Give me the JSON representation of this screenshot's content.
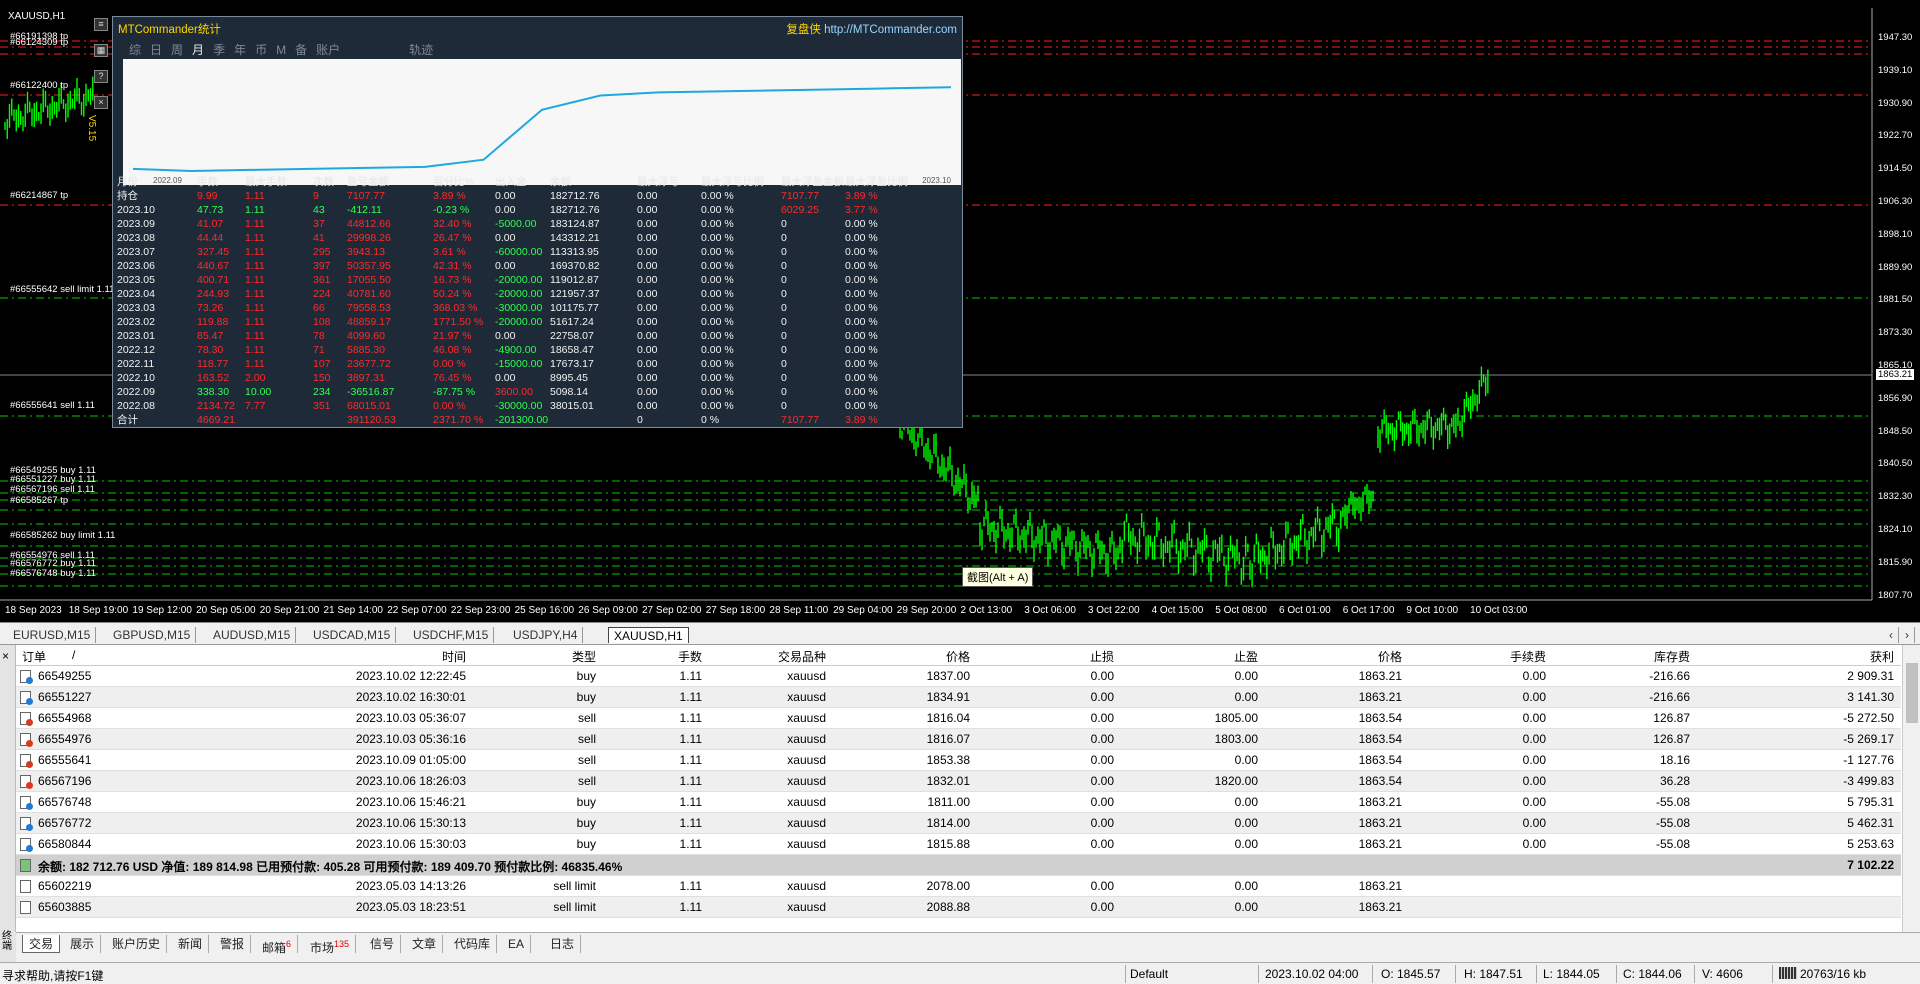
{
  "chart": {
    "symbol_label": "XAUUSD,H1",
    "current_price": "1863.21",
    "price_ticks": [
      "1947.30",
      "1939.10",
      "1930.90",
      "1922.70",
      "1914.50",
      "1906.30",
      "1898.10",
      "1889.90",
      "1881.50",
      "1873.30",
      "1865.10",
      "1856.90",
      "1848.50",
      "1840.50",
      "1832.30",
      "1824.10",
      "1815.90",
      "1807.70"
    ],
    "time_ticks": [
      "18 Sep 2023",
      "18 Sep 19:00",
      "19 Sep 12:00",
      "20 Sep 05:00",
      "20 Sep 21:00",
      "21 Sep 14:00",
      "22 Sep 07:00",
      "22 Sep 23:00",
      "25 Sep 16:00",
      "26 Sep 09:00",
      "27 Sep 02:00",
      "27 Sep 18:00",
      "28 Sep 11:00",
      "29 Sep 04:00",
      "29 Sep 20:00",
      "2 Oct 13:00",
      "3 Oct 06:00",
      "3 Oct 22:00",
      "4 Oct 15:00",
      "5 Oct 08:00",
      "6 Oct 01:00",
      "6 Oct 17:00",
      "9 Oct 10:00",
      "10 Oct 03:00"
    ],
    "order_labels": [
      "#66191398 tp",
      "#66124309 tp",
      "#66122400 tp",
      "#66214867 tp",
      "#66555642 sell limit 1.11",
      "#66555641 sell 1.11",
      "#66549255 buy 1.11",
      "#66551227 buy 1.11",
      "#66567196 sell 1.11",
      "#66585267 tp",
      "#66585262 buy limit 1.11",
      "#66554976 sell 1.11",
      "#66576772 buy 1.11",
      "#66576748 buy 1.11"
    ],
    "screenshot_tip": "截图(Alt + A)",
    "side_icons": [
      "list-icon",
      "grid-icon",
      "question-icon",
      "close-icon"
    ],
    "version_label": "V5.15"
  },
  "mtc": {
    "title": "MTCommander统计",
    "link_prefix": "复盘侠",
    "link_url": "http://MTCommander.com",
    "tabs": [
      "综",
      "日",
      "周",
      "月",
      "季",
      "年",
      "币",
      "M",
      "备",
      "账户",
      "轨迹"
    ],
    "active_tab": "月",
    "plot": {
      "x_start": "2022.09",
      "x_end": "2023.10",
      "line_color": "#1fa8e0",
      "equity": [
        0.04,
        0.02,
        0.03,
        0.04,
        0.05,
        0.06,
        0.13,
        0.62,
        0.76,
        0.79,
        0.8,
        0.81,
        0.82,
        0.83,
        0.84
      ]
    },
    "columns": [
      "月份",
      "手数",
      "最大手数",
      "次数",
      "盈亏金额",
      "百分比%",
      "出入金",
      "余额",
      "最大浮亏",
      "最大浮亏比例",
      "最大浮盈金额",
      "最大浮盈比例"
    ],
    "rows": [
      {
        "c": [
          "持仓",
          "9.99",
          "1.11",
          "9",
          "7107.77",
          "3.89 %",
          "0.00",
          "182712.76",
          "0.00",
          "0.00 %",
          "7107.77",
          "3.89 %"
        ],
        "t": [
          "w",
          "r",
          "r",
          "r",
          "r",
          "r",
          "w",
          "w",
          "w",
          "w",
          "r",
          "r"
        ]
      },
      {
        "c": [
          "2023.10",
          "47.73",
          "1.11",
          "43",
          "-412.11",
          "-0.23 %",
          "0.00",
          "182712.76",
          "0.00",
          "0.00 %",
          "6029.25",
          "3.77 %"
        ],
        "t": [
          "w",
          "g",
          "g",
          "g",
          "g",
          "g",
          "w",
          "w",
          "w",
          "w",
          "r",
          "r"
        ]
      },
      {
        "c": [
          "2023.09",
          "41.07",
          "1.11",
          "37",
          "44812.66",
          "32.40 %",
          "-5000.00",
          "183124.87",
          "0.00",
          "0.00 %",
          "0",
          "0.00 %"
        ],
        "t": [
          "w",
          "r",
          "r",
          "r",
          "r",
          "r",
          "g",
          "w",
          "w",
          "w",
          "w",
          "w"
        ]
      },
      {
        "c": [
          "2023.08",
          "44.44",
          "1.11",
          "41",
          "29998.26",
          "26.47 %",
          "0.00",
          "143312.21",
          "0.00",
          "0.00 %",
          "0",
          "0.00 %"
        ],
        "t": [
          "w",
          "r",
          "r",
          "r",
          "r",
          "r",
          "w",
          "w",
          "w",
          "w",
          "w",
          "w"
        ]
      },
      {
        "c": [
          "2023.07",
          "327.45",
          "1.11",
          "295",
          "3943.13",
          "3.61 %",
          "-60000.00",
          "113313.95",
          "0.00",
          "0.00 %",
          "0",
          "0.00 %"
        ],
        "t": [
          "w",
          "r",
          "r",
          "r",
          "r",
          "r",
          "g",
          "w",
          "w",
          "w",
          "w",
          "w"
        ]
      },
      {
        "c": [
          "2023.06",
          "440.67",
          "1.11",
          "397",
          "50357.95",
          "42.31 %",
          "0.00",
          "169370.82",
          "0.00",
          "0.00 %",
          "0",
          "0.00 %"
        ],
        "t": [
          "w",
          "r",
          "r",
          "r",
          "r",
          "r",
          "w",
          "w",
          "w",
          "w",
          "w",
          "w"
        ]
      },
      {
        "c": [
          "2023.05",
          "400.71",
          "1.11",
          "361",
          "17055.50",
          "16.73 %",
          "-20000.00",
          "119012.87",
          "0.00",
          "0.00 %",
          "0",
          "0.00 %"
        ],
        "t": [
          "w",
          "r",
          "r",
          "r",
          "r",
          "r",
          "g",
          "w",
          "w",
          "w",
          "w",
          "w"
        ]
      },
      {
        "c": [
          "2023.04",
          "244.93",
          "1.11",
          "224",
          "40781.60",
          "50.24 %",
          "-20000.00",
          "121957.37",
          "0.00",
          "0.00 %",
          "0",
          "0.00 %"
        ],
        "t": [
          "w",
          "r",
          "r",
          "r",
          "r",
          "r",
          "g",
          "w",
          "w",
          "w",
          "w",
          "w"
        ]
      },
      {
        "c": [
          "2023.03",
          "73.26",
          "1.11",
          "66",
          "79558.53",
          "368.03 %",
          "-30000.00",
          "101175.77",
          "0.00",
          "0.00 %",
          "0",
          "0.00 %"
        ],
        "t": [
          "w",
          "r",
          "r",
          "r",
          "r",
          "r",
          "g",
          "w",
          "w",
          "w",
          "w",
          "w"
        ]
      },
      {
        "c": [
          "2023.02",
          "119.88",
          "1.11",
          "108",
          "48859.17",
          "1771.50 %",
          "-20000.00",
          "51617.24",
          "0.00",
          "0.00 %",
          "0",
          "0.00 %"
        ],
        "t": [
          "w",
          "r",
          "r",
          "r",
          "r",
          "r",
          "g",
          "w",
          "w",
          "w",
          "w",
          "w"
        ]
      },
      {
        "c": [
          "2023.01",
          "85.47",
          "1.11",
          "78",
          "4099.60",
          "21.97 %",
          "0.00",
          "22758.07",
          "0.00",
          "0.00 %",
          "0",
          "0.00 %"
        ],
        "t": [
          "w",
          "r",
          "r",
          "r",
          "r",
          "r",
          "w",
          "w",
          "w",
          "w",
          "w",
          "w"
        ]
      },
      {
        "c": [
          "2022.12",
          "78.30",
          "1.11",
          "71",
          "5885.30",
          "46.08 %",
          "-4900.00",
          "18658.47",
          "0.00",
          "0.00 %",
          "0",
          "0.00 %"
        ],
        "t": [
          "w",
          "r",
          "r",
          "r",
          "r",
          "r",
          "g",
          "w",
          "w",
          "w",
          "w",
          "w"
        ]
      },
      {
        "c": [
          "2022.11",
          "118.77",
          "1.11",
          "107",
          "23677.72",
          "0.00 %",
          "-15000.00",
          "17673.17",
          "0.00",
          "0.00 %",
          "0",
          "0.00 %"
        ],
        "t": [
          "w",
          "r",
          "r",
          "r",
          "r",
          "r",
          "g",
          "w",
          "w",
          "w",
          "w",
          "w"
        ]
      },
      {
        "c": [
          "2022.10",
          "163.52",
          "2.00",
          "150",
          "3897.31",
          "76.45 %",
          "0.00",
          "8995.45",
          "0.00",
          "0.00 %",
          "0",
          "0.00 %"
        ],
        "t": [
          "w",
          "r",
          "r",
          "r",
          "r",
          "r",
          "w",
          "w",
          "w",
          "w",
          "w",
          "w"
        ]
      },
      {
        "c": [
          "2022.09",
          "338.30",
          "10.00",
          "234",
          "-36516.87",
          "-87.75 %",
          "3600.00",
          "5098.14",
          "0.00",
          "0.00 %",
          "0",
          "0.00 %"
        ],
        "t": [
          "w",
          "g",
          "g",
          "g",
          "g",
          "g",
          "r",
          "w",
          "w",
          "w",
          "w",
          "w"
        ]
      },
      {
        "c": [
          "2022.08",
          "2134.72",
          "7.77",
          "351",
          "68015.01",
          "0.00 %",
          "-30000.00",
          "38015.01",
          "0.00",
          "0.00 %",
          "0",
          "0.00 %"
        ],
        "t": [
          "w",
          "r",
          "r",
          "r",
          "r",
          "r",
          "g",
          "w",
          "w",
          "w",
          "w",
          "w"
        ]
      }
    ],
    "total": {
      "c": [
        "合计",
        "4669.21",
        "",
        "",
        "391120.53",
        "2371.70 %",
        "-201300.00",
        "",
        "0",
        "0 %",
        "7107.77",
        "3.89 %"
      ],
      "t": [
        "w",
        "r",
        "w",
        "w",
        "r",
        "r",
        "g",
        "w",
        "w",
        "w",
        "r",
        "r"
      ]
    }
  },
  "chart_tabs": [
    "EURUSD,M15",
    "GBPUSD,M15",
    "AUDUSD,M15",
    "USDCAD,M15",
    "USDCHF,M15",
    "USDJPY,H4",
    "XAUUSD,H1"
  ],
  "active_chart_tab": "XAUUSD,H1",
  "terminal": {
    "close_glyph": "×",
    "side_label": "终端",
    "columns": [
      "订单",
      "时间",
      "类型",
      "手数",
      "交易品种",
      "价格",
      "止损",
      "止盈",
      "价格",
      "手续费",
      "库存费",
      "获利"
    ],
    "sort_marker": "/",
    "orders": [
      {
        "id": "66549255",
        "time": "2023.10.02 12:22:45",
        "type": "buy",
        "lots": "1.11",
        "symbol": "xauusd",
        "price": "1837.00",
        "sl": "0.00",
        "tp": "0.00",
        "cur": "1863.21",
        "comm": "0.00",
        "swap": "-216.66",
        "profit": "2 909.31"
      },
      {
        "id": "66551227",
        "time": "2023.10.02 16:30:01",
        "type": "buy",
        "lots": "1.11",
        "symbol": "xauusd",
        "price": "1834.91",
        "sl": "0.00",
        "tp": "0.00",
        "cur": "1863.21",
        "comm": "0.00",
        "swap": "-216.66",
        "profit": "3 141.30"
      },
      {
        "id": "66554968",
        "time": "2023.10.03 05:36:07",
        "type": "sell",
        "lots": "1.11",
        "symbol": "xauusd",
        "price": "1816.04",
        "sl": "0.00",
        "tp": "1805.00",
        "cur": "1863.54",
        "comm": "0.00",
        "swap": "126.87",
        "profit": "-5 272.50"
      },
      {
        "id": "66554976",
        "time": "2023.10.03 05:36:16",
        "type": "sell",
        "lots": "1.11",
        "symbol": "xauusd",
        "price": "1816.07",
        "sl": "0.00",
        "tp": "1803.00",
        "cur": "1863.54",
        "comm": "0.00",
        "swap": "126.87",
        "profit": "-5 269.17"
      },
      {
        "id": "66555641",
        "time": "2023.10.09 01:05:00",
        "type": "sell",
        "lots": "1.11",
        "symbol": "xauusd",
        "price": "1853.38",
        "sl": "0.00",
        "tp": "0.00",
        "cur": "1863.54",
        "comm": "0.00",
        "swap": "18.16",
        "profit": "-1 127.76"
      },
      {
        "id": "66567196",
        "time": "2023.10.06 18:26:03",
        "type": "sell",
        "lots": "1.11",
        "symbol": "xauusd",
        "price": "1832.01",
        "sl": "0.00",
        "tp": "1820.00",
        "cur": "1863.54",
        "comm": "0.00",
        "swap": "36.28",
        "profit": "-3 499.83"
      },
      {
        "id": "66576748",
        "time": "2023.10.06 15:46:21",
        "type": "buy",
        "lots": "1.11",
        "symbol": "xauusd",
        "price": "1811.00",
        "sl": "0.00",
        "tp": "0.00",
        "cur": "1863.21",
        "comm": "0.00",
        "swap": "-55.08",
        "profit": "5 795.31"
      },
      {
        "id": "66576772",
        "time": "2023.10.06 15:30:13",
        "type": "buy",
        "lots": "1.11",
        "symbol": "xauusd",
        "price": "1814.00",
        "sl": "0.00",
        "tp": "0.00",
        "cur": "1863.21",
        "comm": "0.00",
        "swap": "-55.08",
        "profit": "5 462.31"
      },
      {
        "id": "66580844",
        "time": "2023.10.06 15:30:03",
        "type": "buy",
        "lots": "1.11",
        "symbol": "xauusd",
        "price": "1815.88",
        "sl": "0.00",
        "tp": "0.00",
        "cur": "1863.21",
        "comm": "0.00",
        "swap": "-55.08",
        "profit": "5 253.63"
      }
    ],
    "summary": "余额: 182 712.76 USD  净值: 189 814.98  已用预付款: 405.28  可用预付款: 189 409.70  预付款比例: 46835.46%",
    "summary_profit": "7 102.22",
    "pending": [
      {
        "id": "65602219",
        "time": "2023.05.03 14:13:26",
        "type": "sell limit",
        "lots": "1.11",
        "symbol": "xauusd",
        "price": "2078.00",
        "sl": "0.00",
        "tp": "0.00",
        "cur": "1863.21"
      },
      {
        "id": "65603885",
        "time": "2023.05.03 18:23:51",
        "type": "sell limit",
        "lots": "1.11",
        "symbol": "xauusd",
        "price": "2088.88",
        "sl": "0.00",
        "tp": "0.00",
        "cur": "1863.21"
      }
    ]
  },
  "bottom_tabs": [
    {
      "label": "交易",
      "badge": ""
    },
    {
      "label": "展示",
      "badge": ""
    },
    {
      "label": "账户历史",
      "badge": ""
    },
    {
      "label": "新闻",
      "badge": ""
    },
    {
      "label": "警报",
      "badge": ""
    },
    {
      "label": "邮箱",
      "badge": "6"
    },
    {
      "label": "市场",
      "badge": "135"
    },
    {
      "label": "信号",
      "badge": ""
    },
    {
      "label": "文章",
      "badge": ""
    },
    {
      "label": "代码库",
      "badge": ""
    },
    {
      "label": "EA",
      "badge": ""
    },
    {
      "label": "日志",
      "badge": ""
    }
  ],
  "active_bottom_tab": "交易",
  "status": {
    "help": "寻求帮助,请按F1键",
    "profile": "Default",
    "datetime": "2023.10.02 04:00",
    "open": "O: 1845.57",
    "high": "H: 1847.51",
    "low": "L: 1844.05",
    "close": "C: 1844.06",
    "volume": "V: 4606",
    "traffic": "20763/16 kb"
  },
  "colors": {
    "buy_line": "#00c800",
    "sell_line": "#ff2020",
    "candle": "#00ff00",
    "profit_neg": "#000",
    "chart_bg": "#000000"
  }
}
